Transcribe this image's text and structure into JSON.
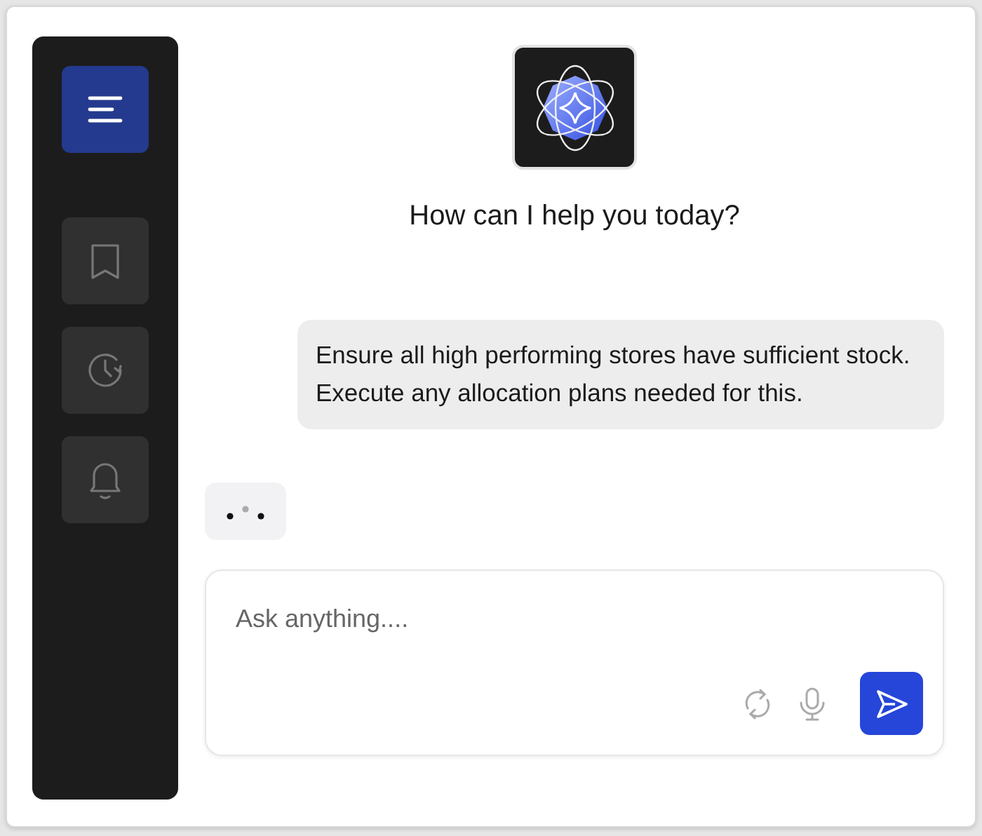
{
  "sidebar": {
    "items": [
      {
        "kind": "menu",
        "selected": true
      },
      {
        "kind": "bookmark",
        "selected": false
      },
      {
        "kind": "history",
        "selected": false
      },
      {
        "kind": "bell",
        "selected": false
      }
    ]
  },
  "greeting": "How can I help you today?",
  "messages": [
    {
      "kind": "user",
      "text": "Ensure all high performing stores have sufficient stock. Execute any allocation plans needed for this."
    },
    {
      "kind": "typing"
    }
  ],
  "composer": {
    "placeholder": "Ask anything...."
  }
}
